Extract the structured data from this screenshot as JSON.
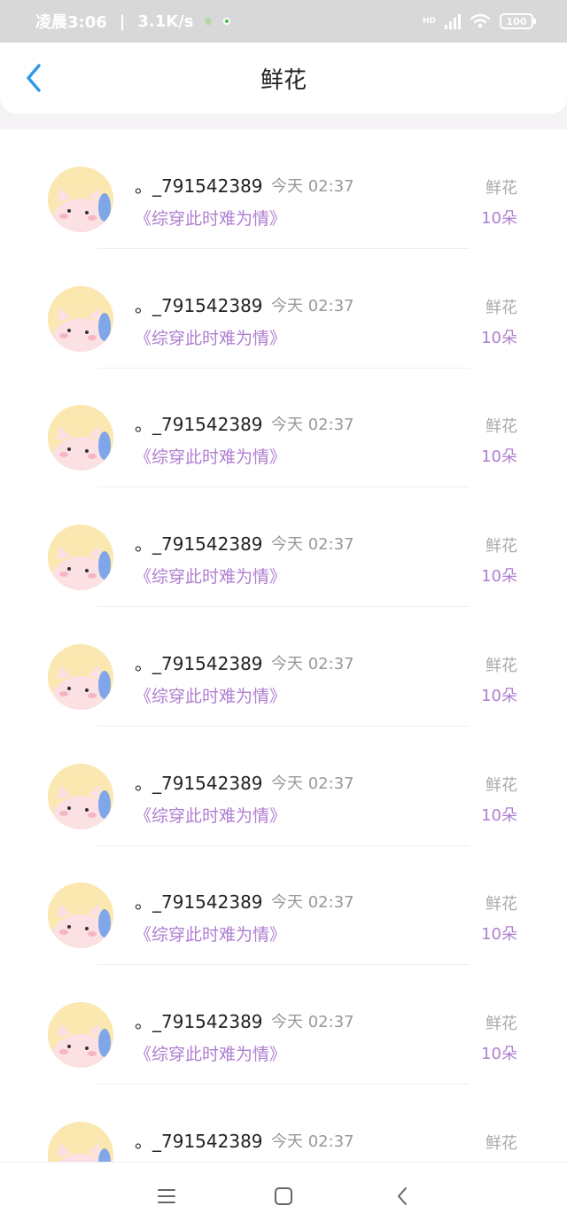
{
  "status_bar": {
    "time": "凌晨3:06",
    "speed": "3.1K/s",
    "battery": "100",
    "network": "HD"
  },
  "header": {
    "title": "鲜花"
  },
  "list": {
    "items": [
      {
        "username": "。_791542389",
        "time": "今天 02:37",
        "book": "《综穿此时难为情》",
        "gift_type": "鲜花",
        "gift_count": "10朵"
      },
      {
        "username": "。_791542389",
        "time": "今天 02:37",
        "book": "《综穿此时难为情》",
        "gift_type": "鲜花",
        "gift_count": "10朵"
      },
      {
        "username": "。_791542389",
        "time": "今天 02:37",
        "book": "《综穿此时难为情》",
        "gift_type": "鲜花",
        "gift_count": "10朵"
      },
      {
        "username": "。_791542389",
        "time": "今天 02:37",
        "book": "《综穿此时难为情》",
        "gift_type": "鲜花",
        "gift_count": "10朵"
      },
      {
        "username": "。_791542389",
        "time": "今天 02:37",
        "book": "《综穿此时难为情》",
        "gift_type": "鲜花",
        "gift_count": "10朵"
      },
      {
        "username": "。_791542389",
        "time": "今天 02:37",
        "book": "《综穿此时难为情》",
        "gift_type": "鲜花",
        "gift_count": "10朵"
      },
      {
        "username": "。_791542389",
        "time": "今天 02:37",
        "book": "《综穿此时难为情》",
        "gift_type": "鲜花",
        "gift_count": "10朵"
      },
      {
        "username": "。_791542389",
        "time": "今天 02:37",
        "book": "《综穿此时难为情》",
        "gift_type": "鲜花",
        "gift_count": "10朵"
      },
      {
        "username": "。_791542389",
        "time": "今天 02:37",
        "book": "",
        "gift_type": "鲜花",
        "gift_count": ""
      }
    ]
  },
  "nav": {
    "icons": [
      "menu-icon",
      "home-icon",
      "back-icon"
    ]
  },
  "colors": {
    "accent": "#b07ed0",
    "back_arrow": "#2f9be8"
  }
}
